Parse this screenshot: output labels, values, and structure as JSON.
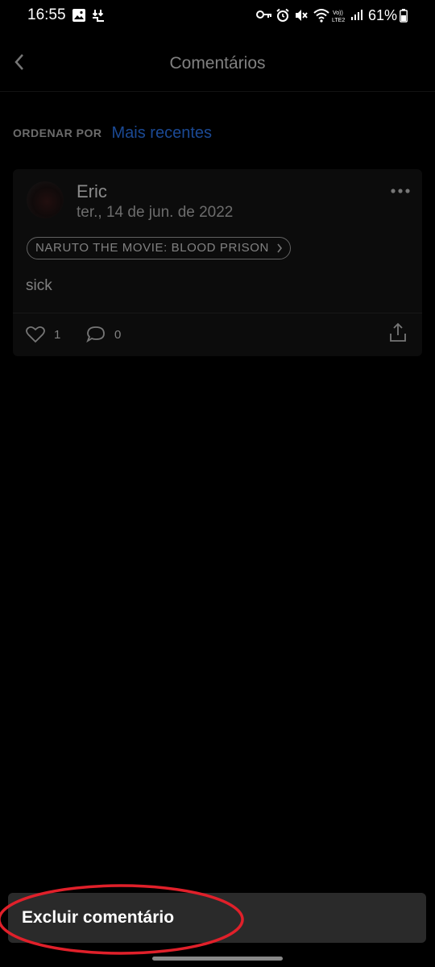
{
  "status_bar": {
    "time": "16:55",
    "battery_percent": "61%",
    "icons_left": [
      "image-icon",
      "download-notify-icon"
    ],
    "icons_right": [
      "vpn-key-icon",
      "alarm-icon",
      "mute-icon",
      "wifi-icon",
      "lte-icon",
      "signal-icon",
      "battery-icon"
    ]
  },
  "header": {
    "title": "Comentários",
    "back_icon": "chevron-left-icon"
  },
  "sort": {
    "label": "ORDENAR POR",
    "value": "Mais recentes"
  },
  "comment": {
    "author": "Eric",
    "date": "ter., 14 de jun. de 2022",
    "tag": "NARUTO THE MOVIE: BLOOD PRISON",
    "text": "sick",
    "likes": "1",
    "replies": "0"
  },
  "action_sheet": {
    "delete_label": "Excluir comentário"
  },
  "colors": {
    "accent": "#2f7fff",
    "annotation": "#e0202a"
  }
}
